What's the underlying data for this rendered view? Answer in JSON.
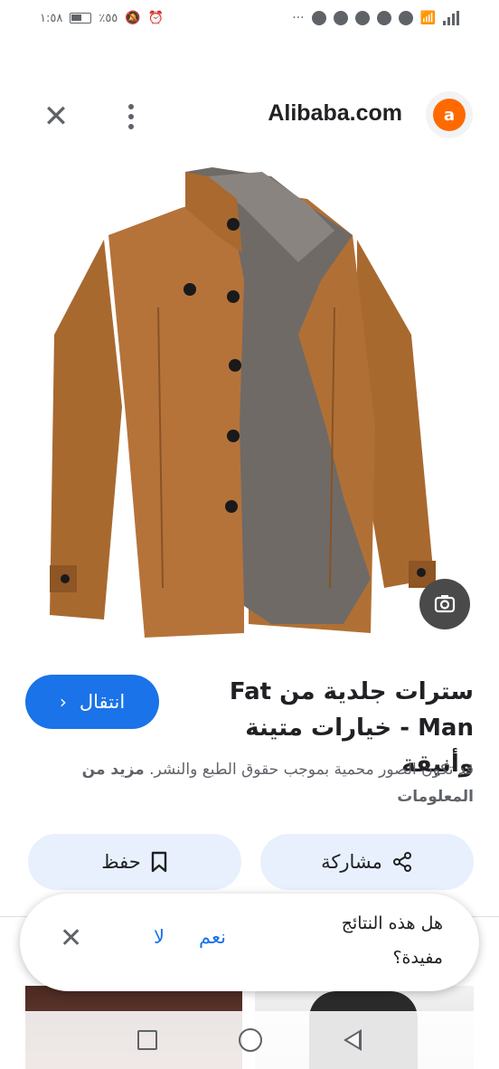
{
  "status_bar": {
    "time": "١:٥٨",
    "battery": "٪٥٥"
  },
  "header": {
    "site_name": "Alibaba.com",
    "close_icon": "close-icon",
    "more_icon": "more-vert-icon"
  },
  "result": {
    "title": "سترات جلدية من Fat Man - خيارات متينة وأنيقة",
    "visit_label": "انتقال",
    "copyright_text": "قد تكون الصور محمية بموجب حقوق الطبع والنشر.",
    "learn_more": "مزيد من المعلومات"
  },
  "actions": {
    "share_label": "مشاركة",
    "save_label": "حفظ"
  },
  "feedback": {
    "question": "هل هذه النتائج مفيدة؟",
    "yes": "نعم",
    "no": "لا"
  },
  "colors": {
    "accent": "#1a73e8",
    "chip_bg": "#e8f0fe",
    "brand": "#ff6a00"
  }
}
